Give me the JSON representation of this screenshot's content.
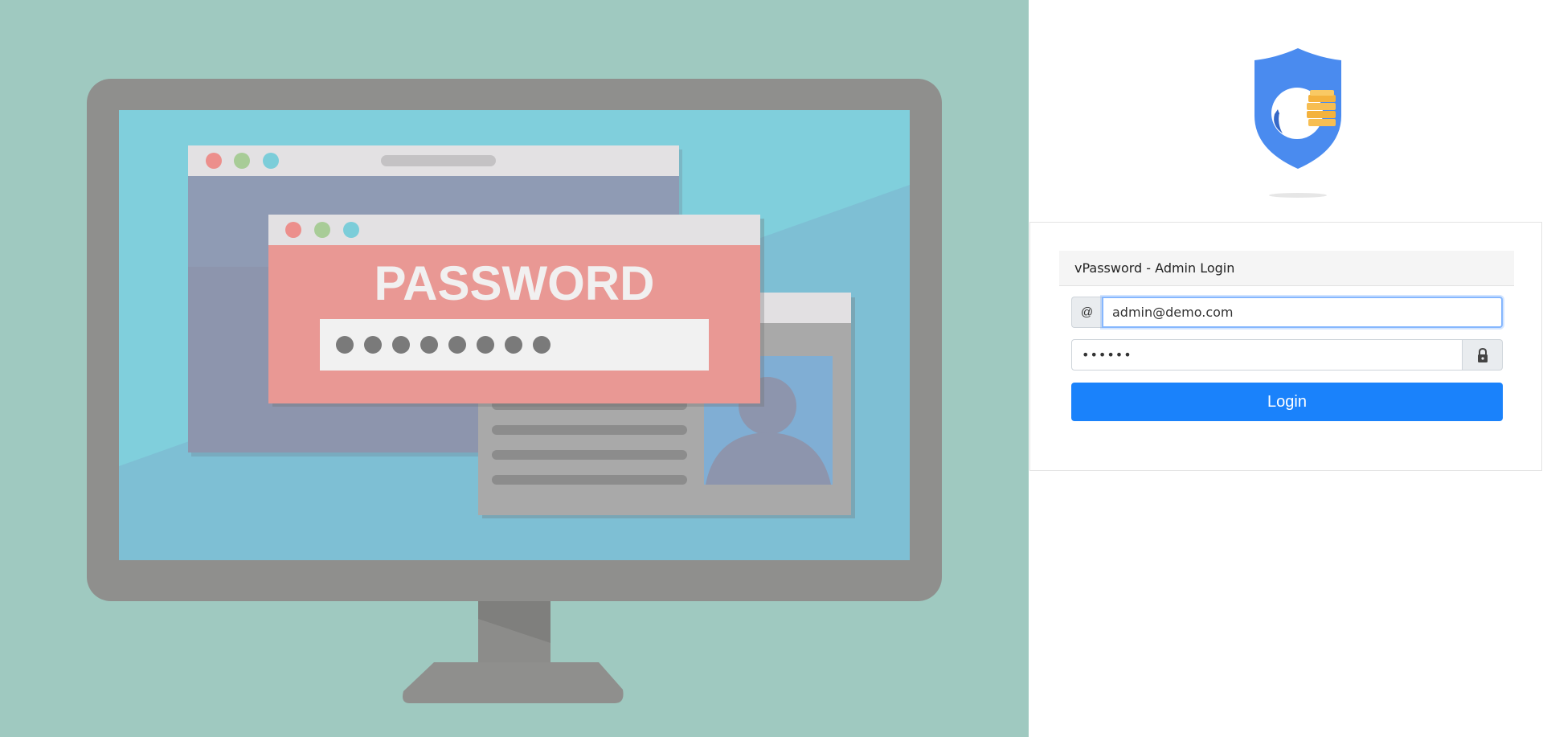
{
  "illustration": {
    "password_heading": "PASSWORD",
    "colors": {
      "background": "#9fc9c0",
      "monitor": "#8f8f8d",
      "screen": "#80cfdc",
      "password_window": "#e99894"
    }
  },
  "logo": {
    "name": "shield-logo",
    "colors": {
      "shield": "#4a8bef",
      "coin": "#f4b23d"
    }
  },
  "login": {
    "title": "vPassword - Admin Login",
    "email_addon": "@",
    "email_value": "admin@demo.com",
    "password_value": "••••••",
    "password_icon": "lock-icon",
    "button_label": "Login",
    "accent_color": "#1a82fb"
  }
}
